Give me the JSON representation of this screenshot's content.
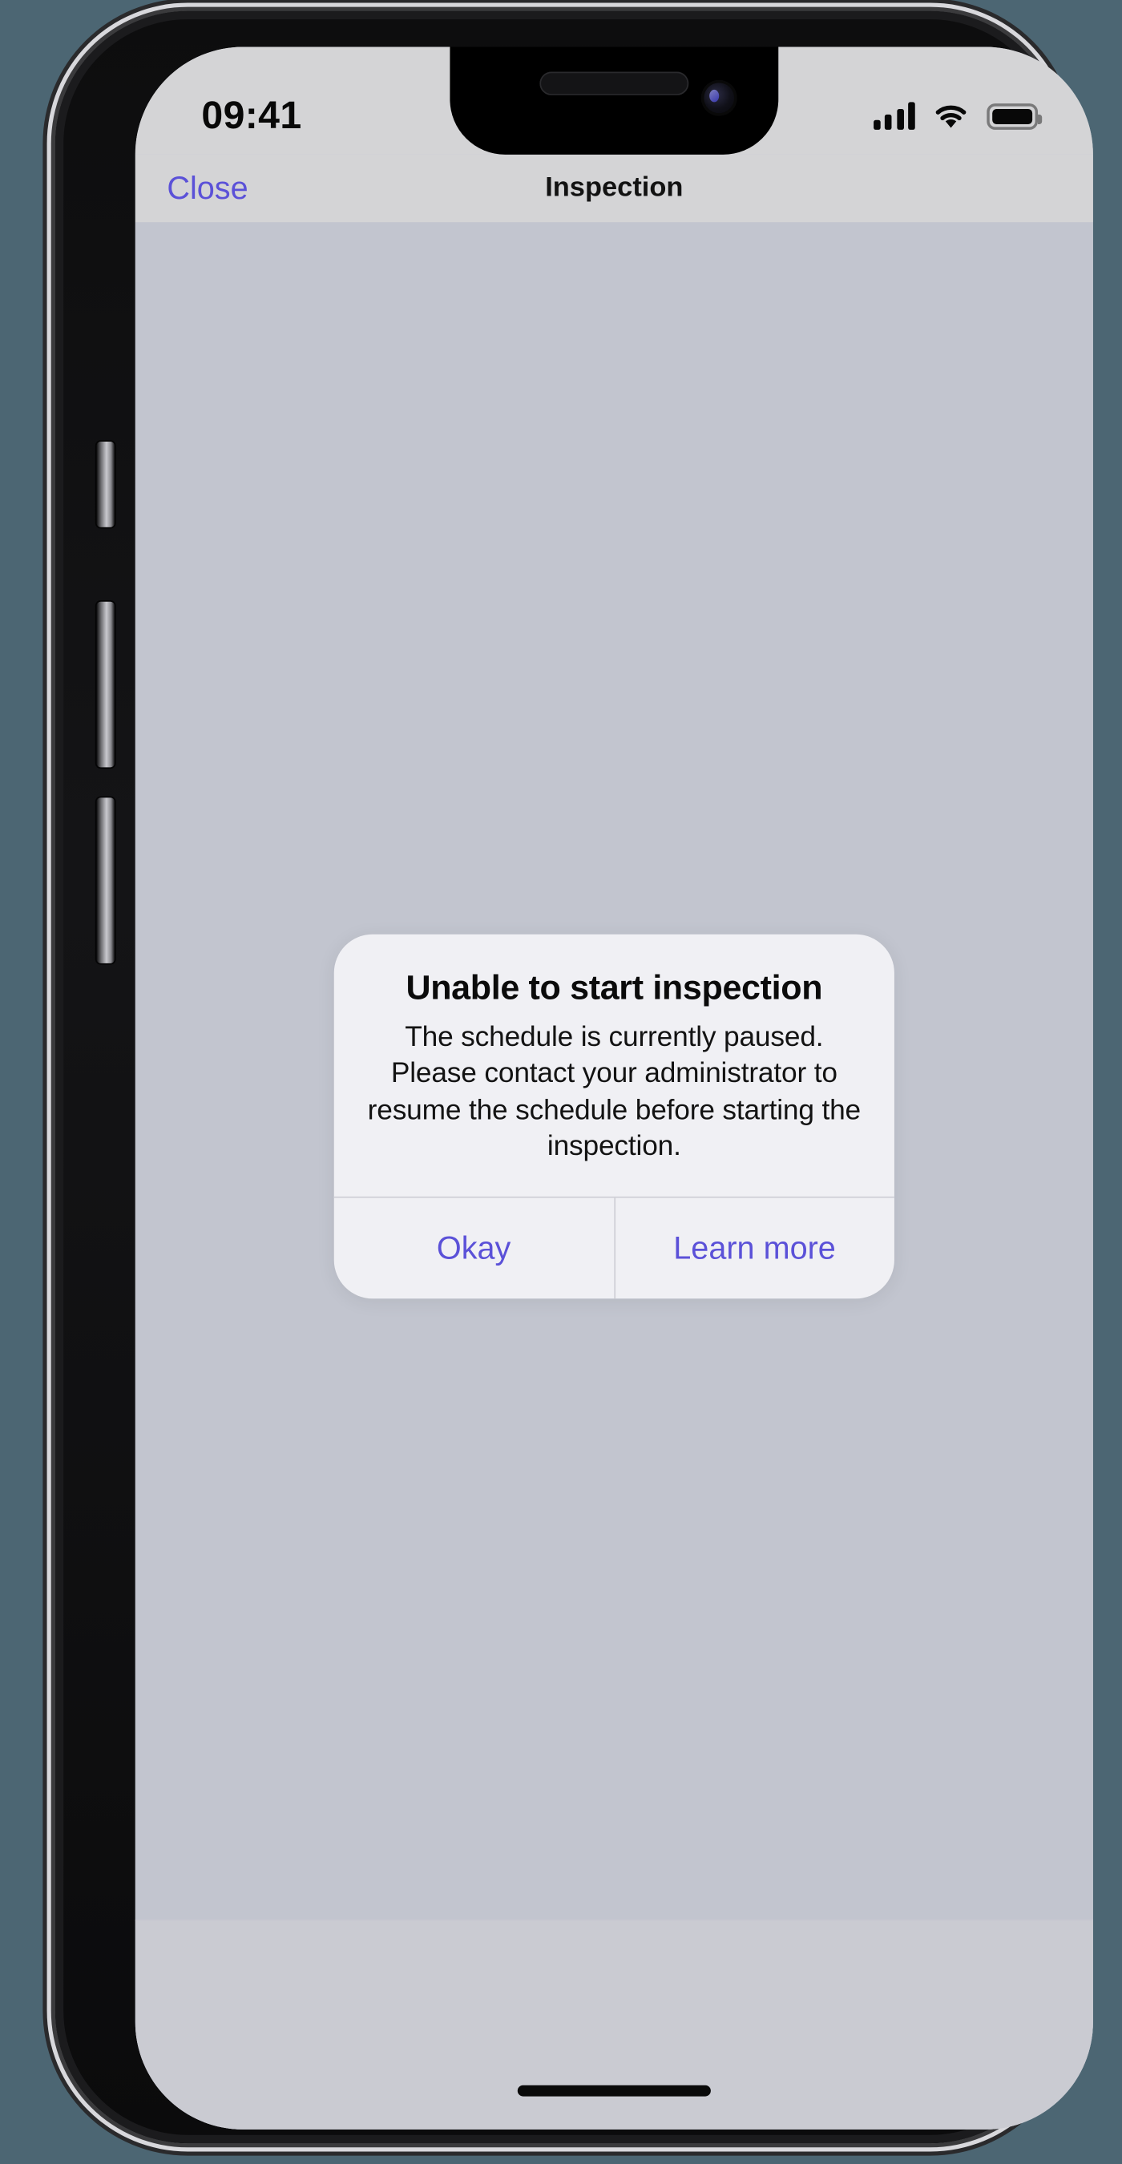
{
  "status_bar": {
    "time": "09:41",
    "cellular_icon": "cellular-signal-icon",
    "wifi_icon": "wifi-icon",
    "battery_icon": "battery-icon",
    "signal_bars": 4
  },
  "nav_bar": {
    "close_label": "Close",
    "title": "Inspection"
  },
  "alert": {
    "title": "Unable to start inspection",
    "message": "The schedule is currently paused. Please contact your administrator to resume the schedule before starting the inspection.",
    "buttons": [
      {
        "label": "Okay"
      },
      {
        "label": "Learn more"
      }
    ]
  },
  "colors": {
    "page_background": "#4c6673",
    "screen_background": "#c2c5cf",
    "bar_background": "#d4d4d6",
    "accent": "#5b51d8",
    "alert_background": "#f0f0f4",
    "separator": "#cfcfd6"
  },
  "device": {
    "home_indicator": "home-indicator",
    "notch": "notch",
    "buttons": [
      "mute-switch",
      "volume-up",
      "volume-down",
      "power"
    ]
  }
}
